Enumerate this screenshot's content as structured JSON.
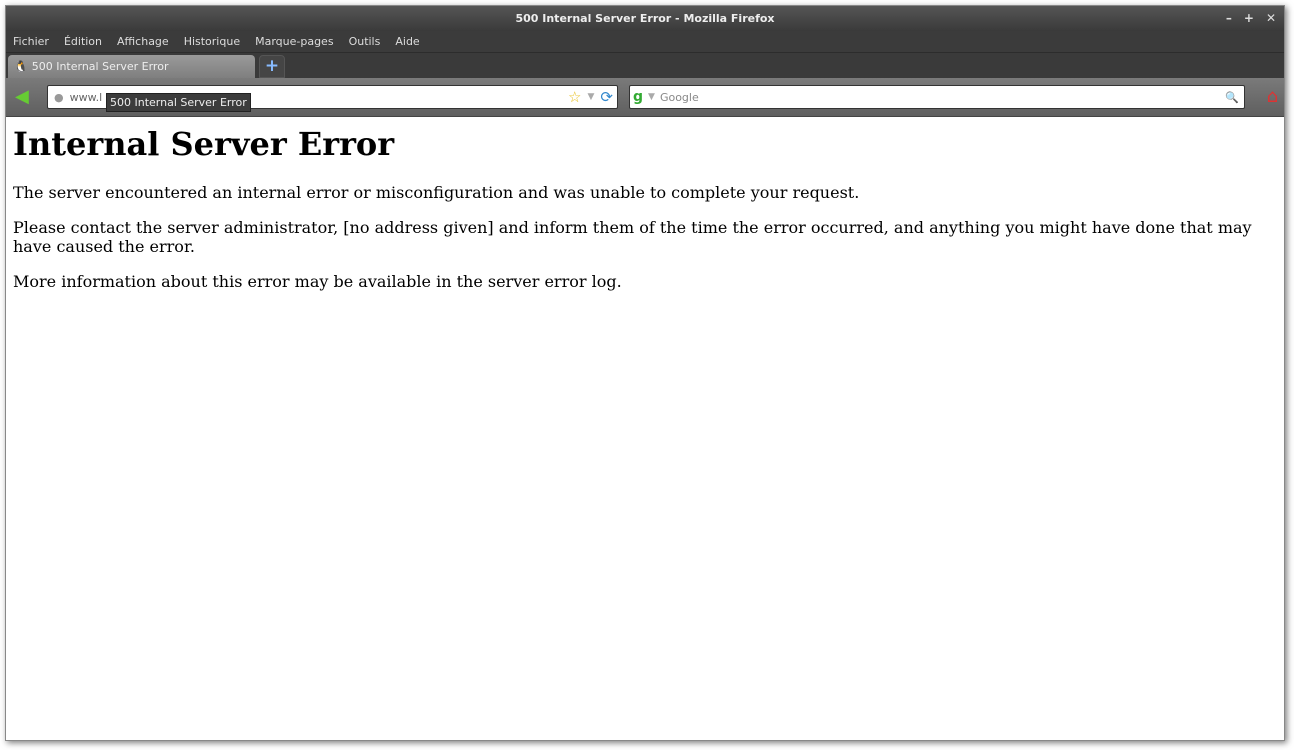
{
  "window": {
    "title": "500 Internal Server Error - Mozilla Firefox",
    "controls": [
      "–",
      "+",
      "✕"
    ]
  },
  "menu": [
    "Fichier",
    "Édition",
    "Affichage",
    "Historique",
    "Marque-pages",
    "Outils",
    "Aide"
  ],
  "tab": {
    "label": "500 Internal Server Error",
    "new_tab": "+"
  },
  "nav": {
    "url": "www.l",
    "search_placeholder": "Google"
  },
  "tooltip": "500 Internal Server Error",
  "page": {
    "heading": "Internal Server Error",
    "paragraphs": [
      "The server encountered an internal error or misconfiguration and was unable to complete your request.",
      "Please contact the server administrator, [no address given] and inform them of the time the error occurred, and anything you might have done that may have caused the error.",
      "More information about this error may be available in the server error log."
    ]
  }
}
